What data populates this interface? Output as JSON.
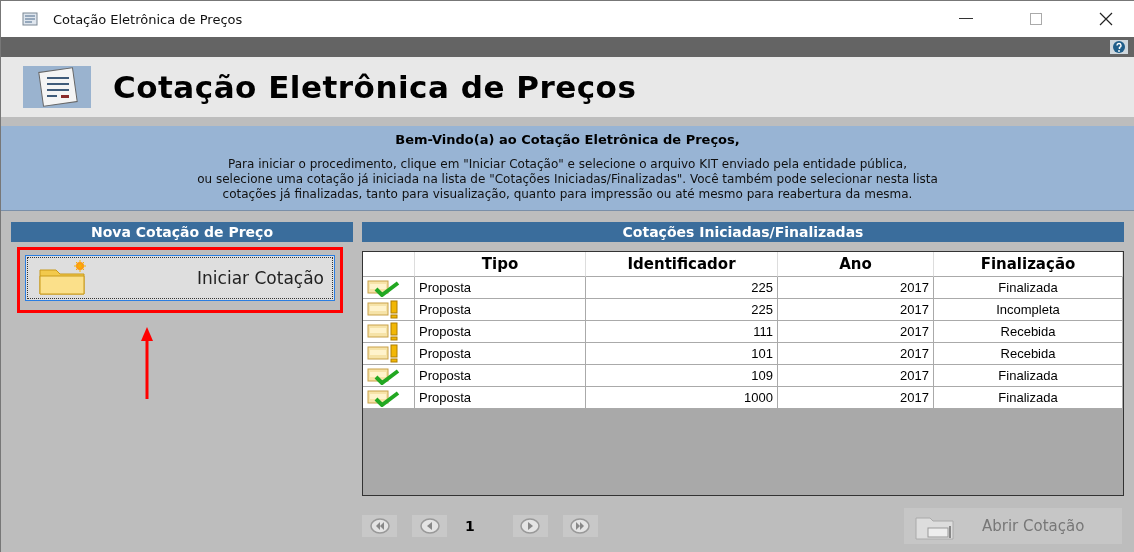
{
  "window": {
    "title": "Cotação Eletrônica de Preços"
  },
  "header": {
    "title": "Cotação Eletrônica de Preços"
  },
  "welcome": {
    "title": "Bem-Vindo(a) ao Cotação Eletrônica de Preços,",
    "lines": [
      "Para iniciar o procedimento, clique em \"Iniciar Cotação\" e selecione o arquivo KIT enviado pela entidade pública,",
      "ou selecione uma cotação já iniciada na lista de \"Cotações Iniciadas/Finalizadas\". Você também pode selecionar nesta lista",
      "cotações já finalizadas, tanto para visualização, quanto para impressão ou até mesmo para reabertura da mesma."
    ]
  },
  "new_panel": {
    "title": "Nova Cotação de Preço",
    "button": "Iniciar Cotação",
    "highlighted": true
  },
  "list_panel": {
    "title": "Cotações Iniciadas/Finalizadas",
    "columns": [
      "Tipo",
      "Identificador",
      "Ano",
      "Finalização"
    ],
    "rows": [
      {
        "kind": "done",
        "cells": [
          "Proposta",
          "225",
          "2017",
          "Finalizada"
        ]
      },
      {
        "kind": "pending",
        "cells": [
          "Proposta",
          "225",
          "2017",
          "Incompleta"
        ]
      },
      {
        "kind": "pending",
        "cells": [
          "Proposta",
          "111",
          "2017",
          "Recebida"
        ]
      },
      {
        "kind": "pending",
        "cells": [
          "Proposta",
          "101",
          "2017",
          "Recebida"
        ]
      },
      {
        "kind": "done",
        "cells": [
          "Proposta",
          "109",
          "2017",
          "Finalizada"
        ]
      },
      {
        "kind": "done",
        "cells": [
          "Proposta",
          "1000",
          "2017",
          "Finalizada"
        ]
      }
    ],
    "page": "1",
    "open_button": {
      "label": "Abrir Cotação",
      "disabled": true
    }
  }
}
